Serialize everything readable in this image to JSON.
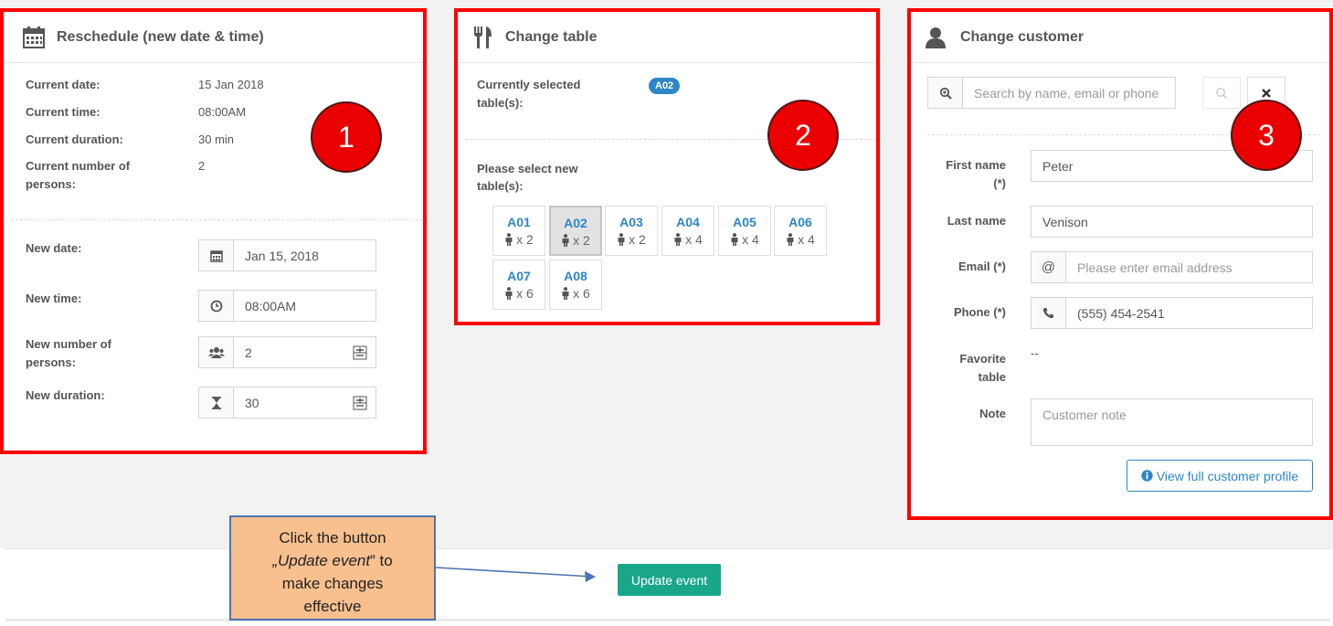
{
  "reschedule": {
    "title": "Reschedule (new date & time)",
    "current_date_label": "Current date:",
    "current_date": "15 Jan 2018",
    "current_time_label": "Current time:",
    "current_time": "08:00AM",
    "current_duration_label": "Current duration:",
    "current_duration": "30 min",
    "current_persons_label_1": "Current number of",
    "current_persons_label_2": "persons:",
    "current_persons": "2",
    "new_date_label": "New date:",
    "new_date": "Jan 15, 2018",
    "new_time_label": "New time:",
    "new_time": "08:00AM",
    "new_persons_label_1": "New number of",
    "new_persons_label_2": "persons:",
    "new_persons": "2",
    "new_duration_label": "New duration:",
    "new_duration": "30",
    "marker": "1"
  },
  "change_table": {
    "title": "Change table",
    "currently_label_1": "Currently selected",
    "currently_label_2": "table(s):",
    "current_badge": "A02",
    "select_label_1": "Please select new",
    "select_label_2": "table(s):",
    "tables": [
      {
        "name": "A01",
        "cap": "x 2"
      },
      {
        "name": "A02",
        "cap": "x 2",
        "selected": true
      },
      {
        "name": "A03",
        "cap": "x 2"
      },
      {
        "name": "A04",
        "cap": "x 4"
      },
      {
        "name": "A05",
        "cap": "x 4"
      },
      {
        "name": "A06",
        "cap": "x 4"
      },
      {
        "name": "A07",
        "cap": "x 6"
      },
      {
        "name": "A08",
        "cap": "x 6"
      }
    ],
    "marker": "2"
  },
  "change_customer": {
    "title": "Change customer",
    "search_placeholder": "Search by name, email or phone",
    "first_name_label_1": "First name",
    "first_name_label_2": "(*)",
    "first_name": "Peter",
    "last_name_label": "Last name",
    "last_name": "Venison",
    "email_label": "Email (*)",
    "email_placeholder": "Please enter email address",
    "phone_label": "Phone (*)",
    "phone": "(555) 454-2541",
    "favorite_label_1": "Favorite",
    "favorite_label_2": "table",
    "favorite_value": "--",
    "note_label": "Note",
    "note_placeholder": "Customer note",
    "profile_button": "View full customer profile",
    "marker": "3"
  },
  "footer": {
    "update_button": "Update event",
    "callout_line1": "Click the button",
    "callout_line2_italic": "„Update event",
    "callout_line2_rest": "” to",
    "callout_line3": "make changes",
    "callout_line4": "effective"
  },
  "colors": {
    "highlight_border": "#ff0000",
    "marker_fill": "#ea0000",
    "link_blue": "#2d86c6",
    "update_green": "#1aa68a",
    "callout_fill": "#f8c08e"
  }
}
